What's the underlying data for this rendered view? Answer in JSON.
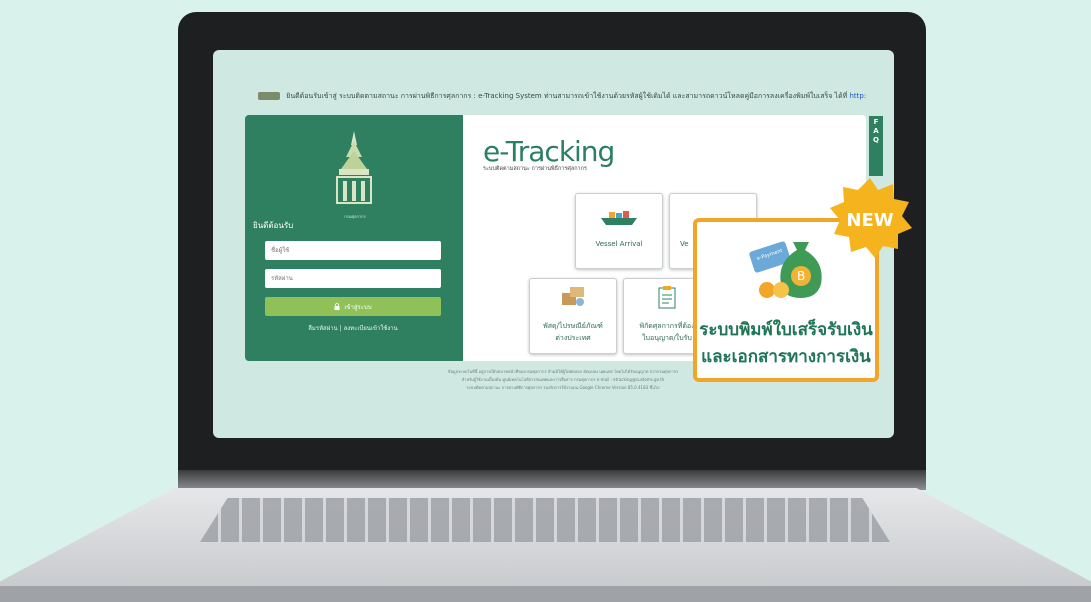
{
  "ticker": {
    "text": "ยินดีต้อนรับเข้าสู่ ระบบติดตามสถานะ การผ่านพิธีการศุลกากร : e-Tracking System ท่านสามารถเข้าใช้งานด้วยรหัสผู้ใช้เดิมได้ และสามารถดาวน์โหลดคู่มือการลงเครื่องพิมพ์ใบเสร็จ ได้ที่",
    "link": "http:"
  },
  "login": {
    "emblem_caption": "กรมศุลกากร",
    "welcome": "ยินดีต้อนรับ",
    "username_placeholder": "ชื่อผู้ใช้",
    "password_placeholder": "รหัสผ่าน",
    "login_button": "เข้าสู่ระบบ",
    "forgot_password": "ลืมรหัสผ่าน",
    "separator": "|",
    "register": "ลงทะเบียนเข้าใช้งาน"
  },
  "brand": {
    "title": "e-Tracking",
    "subtitle": "ระบบติดตามสถานะ การผ่านพิธีการศุลกากร"
  },
  "tiles": {
    "vessel": "Vessel Arrival",
    "second": "Ve",
    "parcel_l1": "พัสดุ/ไปรษณีย์ภัณฑ์",
    "parcel_l2": "ต่างประเทศ",
    "permit_l1": "พิกัดศุลกากรที่ต้อง",
    "permit_l2": "ใบอนุญาต/ใบรับ"
  },
  "faq": "FAQ",
  "footer": {
    "line1": "ข้อมูลระบบในที่นี้ อยู่ภายใต้บทบาทหน้าที่ของกรมศุลกากร ห้ามมิให้ผู้ใดคัดลอก ดัดแปลง เผยแพร่ โดยไม่ได้รับอนุญาต จากกรมศุลกากร",
    "line2": "สำหรับผู้ใช้งานเบื้องต้น ศูนย์เทคโนโลยีสารสนเทศและการสื่อสาร กรมศุลกากร e-mail : etracking@customs.go.th",
    "line3": "ระบบติดตามสถานะ การผ่านพิธีการศุลกากร รองรับการใช้งานบน Google Chrome Version 85.0.4183 ขึ้นไป"
  },
  "popup": {
    "line1": "ระบบพิมพ์ใบเสร็จรับเงิน",
    "line2": "และเอกสารทางการเงิน",
    "badge": "NEW",
    "card_text": "e-Payment",
    "coin_symbol": "B"
  },
  "colors": {
    "brand_green": "#2e8060",
    "accent_orange": "#f2a526",
    "login_button": "#8fc158"
  }
}
